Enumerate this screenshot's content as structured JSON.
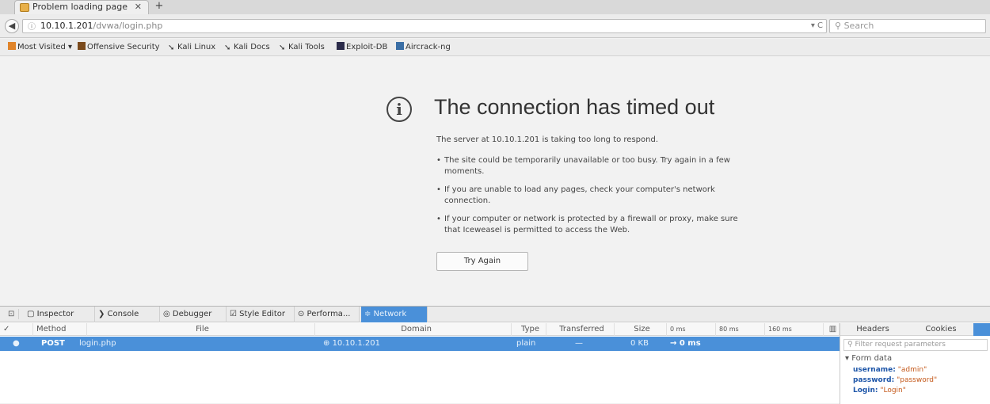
{
  "tab": {
    "title": "Problem loading page",
    "close": "✕",
    "newtab": "+"
  },
  "navbar": {
    "url_host": "10.10.1.201",
    "url_path": "/dvwa/login.php",
    "url_actions": "▾ C",
    "search_placeholder": "Search"
  },
  "bookmarks": [
    {
      "label": "Most Visited ▾",
      "color": "#e0842a"
    },
    {
      "label": "Offensive Security",
      "color": "#7a4a1c"
    },
    {
      "label": "Kali Linux",
      "color": "#333333"
    },
    {
      "label": "Kali Docs",
      "color": "#333333"
    },
    {
      "label": "Kali Tools",
      "color": "#333333"
    },
    {
      "label": "Exploit-DB",
      "color": "#2b2b4a"
    },
    {
      "label": "Aircrack-ng",
      "color": "#3a6ea5"
    }
  ],
  "error": {
    "title": "The connection has timed out",
    "description": "The server at 10.10.1.201 is taking too long to respond.",
    "items": [
      "The site could be temporarily unavailable or too busy. Try again in a few moments.",
      "If you are unable to load any pages, check your computer's network connection.",
      "If your computer or network is protected by a firewall or proxy, make sure that Iceweasel is permitted to access the Web."
    ],
    "button": "Try Again"
  },
  "devtools": {
    "tabs": [
      {
        "label": "▢ Inspector",
        "active": false
      },
      {
        "label": "❯ Console",
        "active": false
      },
      {
        "label": "◎ Debugger",
        "active": false
      },
      {
        "label": "☑ Style Editor",
        "active": false
      },
      {
        "label": "⊙ Performa...",
        "active": false
      },
      {
        "label": "≑ Network",
        "active": true
      }
    ],
    "columns": [
      "✓",
      "Method",
      "File",
      "Domain",
      "Type",
      "Transferred",
      "Size",
      "0 ms",
      "80 ms",
      "160 ms"
    ],
    "row": {
      "method": "POST",
      "file": "login.php",
      "domain": "10.10.1.201",
      "type": "plain",
      "transferred": "—",
      "size": "0 KB",
      "timing": "→ 0 ms"
    },
    "side": {
      "tabs": [
        "Headers",
        "Cookies"
      ],
      "filter_placeholder": "Filter request parameters",
      "form_data_label": "Form data",
      "params": [
        {
          "key": "username:",
          "value": "\"admin\""
        },
        {
          "key": "password:",
          "value": "\"password\""
        },
        {
          "key": "Login:",
          "value": "\"Login\""
        }
      ]
    }
  }
}
